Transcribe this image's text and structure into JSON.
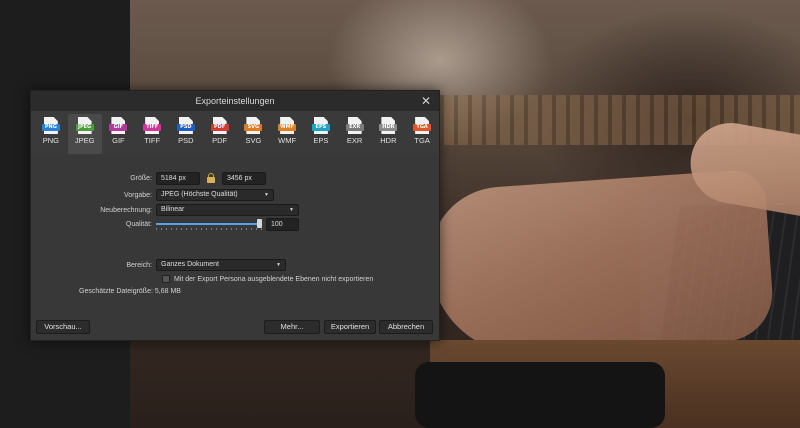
{
  "dialog": {
    "title": "Exporteinstellungen",
    "close_glyph": "✕"
  },
  "formats": [
    {
      "label": "PNG",
      "tag": "PNG",
      "color": "#2a7fd4",
      "selected": false
    },
    {
      "label": "JPEG",
      "tag": "JPEG",
      "color": "#4a9c3c",
      "selected": true
    },
    {
      "label": "GIF",
      "tag": "GIF",
      "color": "#b2389a",
      "selected": false
    },
    {
      "label": "TIFF",
      "tag": "TIFF",
      "color": "#d2359a",
      "selected": false
    },
    {
      "label": "PSD",
      "tag": "PSD",
      "color": "#1f5ec2",
      "selected": false
    },
    {
      "label": "PDF",
      "tag": "PDF",
      "color": "#d63a2e",
      "selected": false
    },
    {
      "label": "SVG",
      "tag": "SVG",
      "color": "#e07a1a",
      "selected": false
    },
    {
      "label": "WMF",
      "tag": "WMF",
      "color": "#e0801e",
      "selected": false
    },
    {
      "label": "EPS",
      "tag": "EPS",
      "color": "#1fa3c4",
      "selected": false
    },
    {
      "label": "EXR",
      "tag": "EXR",
      "color": "#7a7a7a",
      "selected": false
    },
    {
      "label": "HDR",
      "tag": "HDR",
      "color": "#8a8a8a",
      "selected": false
    },
    {
      "label": "TGA",
      "tag": "TGA",
      "color": "#e0552a",
      "selected": false
    }
  ],
  "settings": {
    "size_label": "Größe:",
    "width": "5184 px",
    "height": "3456 px",
    "preset_label": "Vorgabe:",
    "preset_value": "JPEG (Höchste Qualität)",
    "resample_label": "Neuberechnung:",
    "resample_value": "Bilinear",
    "quality_label": "Qualität:",
    "quality_value": "100",
    "quality_fraction": 1.0,
    "area_label": "Bereich:",
    "area_value": "Ganzes Dokument",
    "hidden_layers_text": "Mit der Export Persona ausgeblendete Ebenen nicht exportieren",
    "hidden_layers_checked": false,
    "estimated_size_text": "Geschätzte Dateigröße: 5,68 MB"
  },
  "buttons": {
    "preview": "Vorschau...",
    "more": "Mehr...",
    "export": "Exportieren",
    "cancel": "Abbrechen"
  }
}
